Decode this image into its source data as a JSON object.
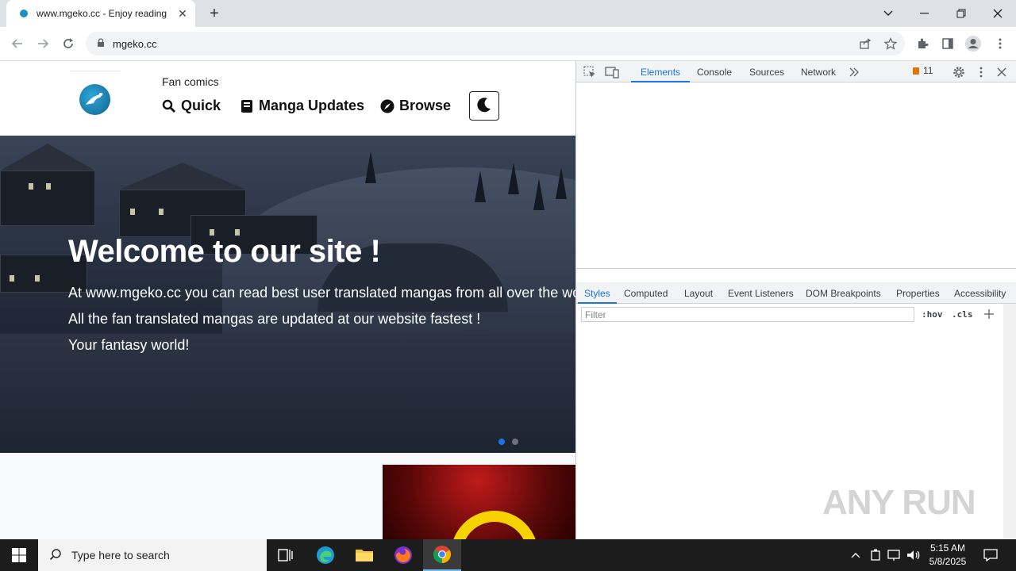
{
  "browser": {
    "tab_title": "www.mgeko.cc - Enjoy reading",
    "url": "mgeko.cc"
  },
  "site": {
    "subtitle": "Fan comics",
    "nav": [
      {
        "label": "Quick",
        "icon": "search-icon"
      },
      {
        "label": "Manga Updates",
        "icon": "book-icon"
      },
      {
        "label": "Browse",
        "icon": "compass-icon"
      }
    ],
    "hero": {
      "title": "Welcome to our site !",
      "line1": "At www.mgeko.cc you can read best user translated mangas from all over the world !",
      "line2": "All the fan translated mangas are updated at our website fastest !",
      "line3": "Your fantasy world!"
    },
    "carousel_active_color": "#1a73e8"
  },
  "devtools": {
    "tabs": [
      "Elements",
      "Console",
      "Sources",
      "Network"
    ],
    "active_tab": "Elements",
    "issues_count": "11",
    "lower_tabs": [
      "Styles",
      "Computed",
      "Layout",
      "Event Listeners",
      "DOM Breakpoints",
      "Properties",
      "Accessibility"
    ],
    "filter_placeholder": "Filter",
    "hov": ":hov",
    "cls": ".cls",
    "accent": "#1a73e8"
  },
  "watermark": "ANY RUN",
  "taskbar": {
    "search_placeholder": "Type here to search",
    "time": "5:15 AM",
    "date": "5/8/2025"
  }
}
